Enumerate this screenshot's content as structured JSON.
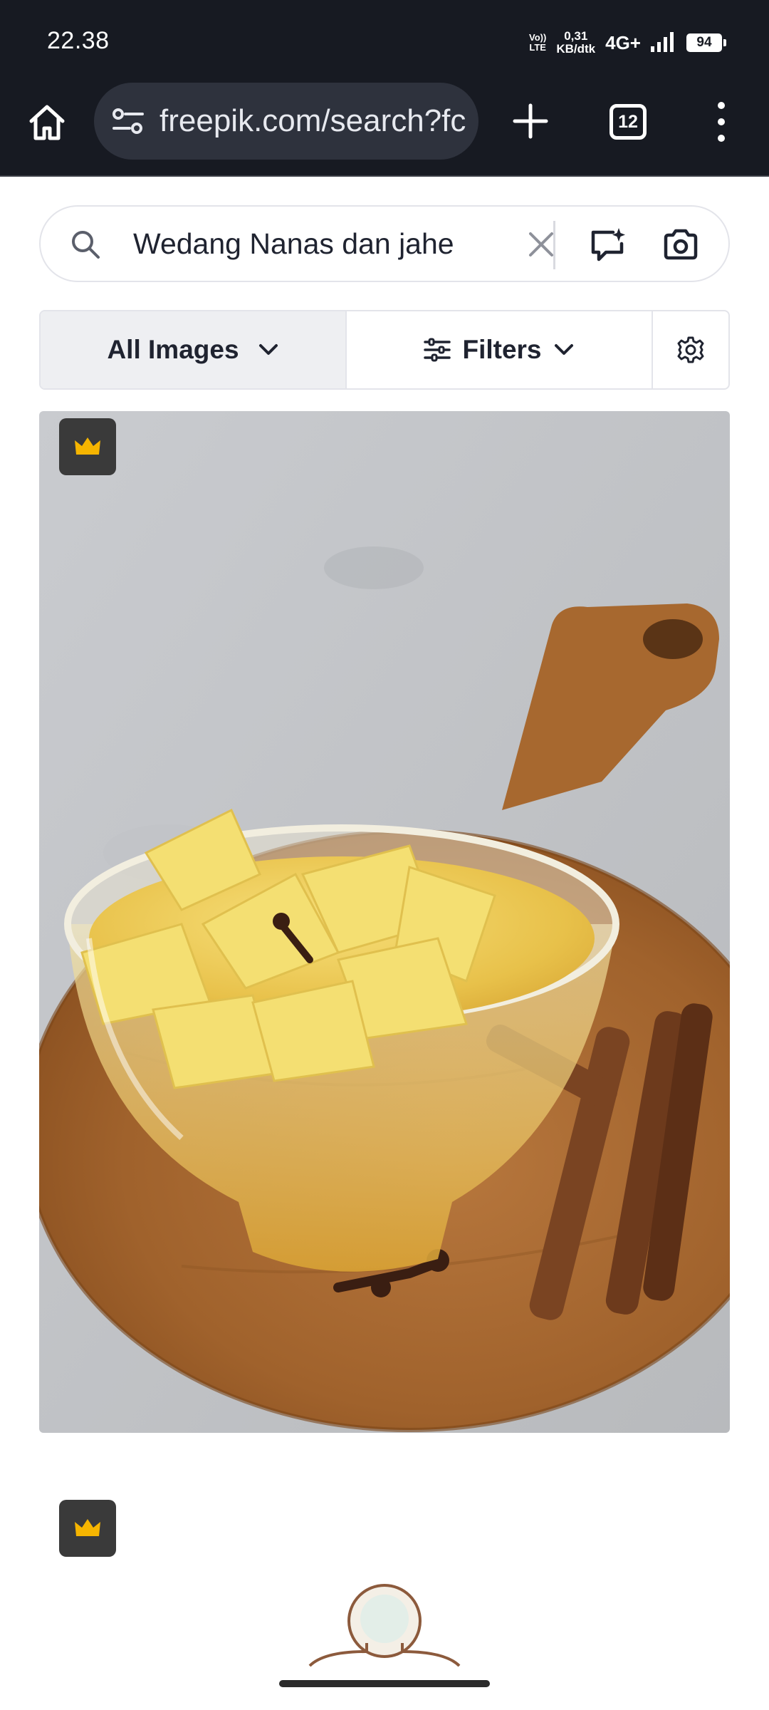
{
  "status_bar": {
    "time": "22.38",
    "volte_top": "Vo))",
    "volte_bottom": "LTE",
    "speed_value": "0,31",
    "speed_unit": "KB/dtk",
    "network": "4G+",
    "battery": "94"
  },
  "browser": {
    "url": "freepik.com/search?fc",
    "tab_count": "12"
  },
  "search": {
    "query": "Wedang Nanas dan jahe"
  },
  "filters": {
    "type_label": "All Images",
    "filters_label": "Filters"
  },
  "results": [
    {
      "premium_icon": "crown-icon"
    },
    {
      "premium_icon": "crown-icon"
    }
  ],
  "colors": {
    "status_bg": "#171a22",
    "url_pill": "#2e323d",
    "crown": "#f6b500",
    "badge_bg": "#3a3a3a"
  }
}
